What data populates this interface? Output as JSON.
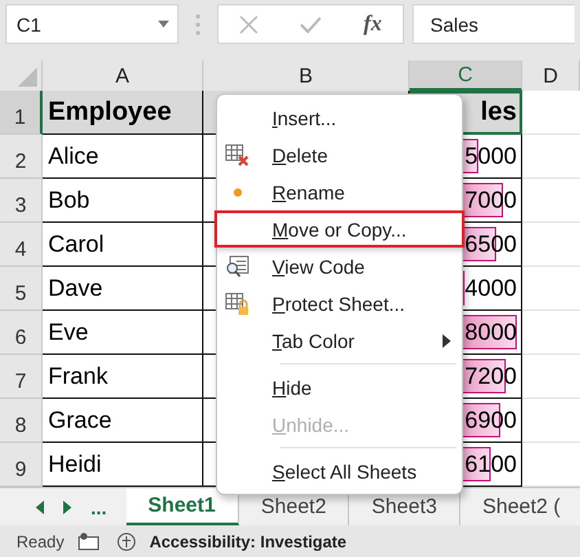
{
  "name_box": {
    "value": "C1"
  },
  "formula_bar": {
    "fx": "fx",
    "value": "Sales"
  },
  "columns": [
    {
      "label": "A",
      "selected": false
    },
    {
      "label": "B",
      "selected": false
    },
    {
      "label": "C",
      "selected": true
    },
    {
      "label": "D",
      "selected": false
    }
  ],
  "header_row": {
    "number": "1",
    "selected": true,
    "a": "Employee",
    "c": "les"
  },
  "rows": [
    {
      "number": "2",
      "a": "Alice",
      "c": "5000",
      "level": 0.6
    },
    {
      "number": "3",
      "a": "Bob",
      "c": "7000",
      "level": 0.83
    },
    {
      "number": "4",
      "a": "Carol",
      "c": "6500",
      "level": 0.77
    },
    {
      "number": "5",
      "a": "Dave",
      "c": "4000",
      "level": 0.48
    },
    {
      "number": "6",
      "a": "Eve",
      "c": "8000",
      "level": 0.95
    },
    {
      "number": "7",
      "a": "Frank",
      "c": "7200",
      "level": 0.85
    },
    {
      "number": "8",
      "a": "Grace",
      "c": "6900",
      "level": 0.8
    },
    {
      "number": "9",
      "a": "Heidi",
      "c": "6100",
      "level": 0.72
    }
  ],
  "context_menu": [
    {
      "kind": "item",
      "label": "Insert...",
      "disabled": false,
      "highlighted": false,
      "submenu": false
    },
    {
      "kind": "item",
      "label": "Delete",
      "disabled": false,
      "highlighted": false,
      "submenu": false
    },
    {
      "kind": "item",
      "label": "Rename",
      "disabled": false,
      "highlighted": false,
      "submenu": false
    },
    {
      "kind": "item",
      "label": "Move or Copy...",
      "disabled": false,
      "highlighted": true,
      "submenu": false
    },
    {
      "kind": "item",
      "label": "View Code",
      "disabled": false,
      "highlighted": false,
      "submenu": false
    },
    {
      "kind": "item",
      "label": "Protect Sheet...",
      "disabled": false,
      "highlighted": false,
      "submenu": false
    },
    {
      "kind": "item",
      "label": "Tab Color",
      "disabled": false,
      "highlighted": false,
      "submenu": true
    },
    {
      "kind": "separator"
    },
    {
      "kind": "item",
      "label": "Hide",
      "disabled": false,
      "highlighted": false,
      "submenu": false
    },
    {
      "kind": "item",
      "label": "Unhide...",
      "disabled": true,
      "highlighted": false,
      "submenu": false
    },
    {
      "kind": "separator"
    },
    {
      "kind": "item",
      "label": "Select All Sheets",
      "disabled": false,
      "highlighted": false,
      "submenu": false
    }
  ],
  "sheet_nav": {
    "more": "..."
  },
  "tabs": [
    {
      "label": "Sheet1",
      "selected": true
    },
    {
      "label": "Sheet2",
      "selected": false
    },
    {
      "label": "Sheet3",
      "selected": false
    },
    {
      "label": "Sheet2 (",
      "selected": false
    }
  ],
  "status_bar": {
    "mode": "Ready",
    "accessibility": "Accessibility: Investigate"
  }
}
